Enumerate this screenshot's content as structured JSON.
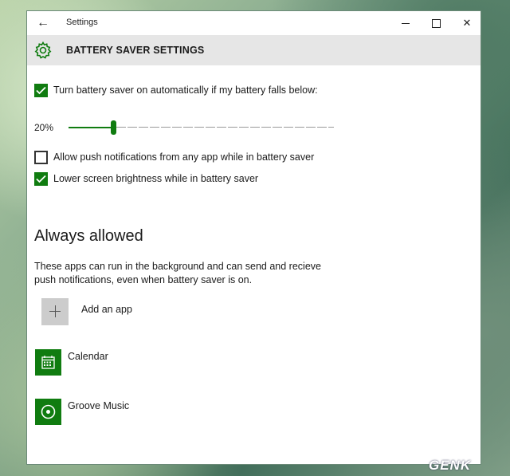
{
  "window": {
    "title": "Settings",
    "back_glyph": "←",
    "close_glyph": "✕"
  },
  "header": {
    "icon": "gear-icon",
    "title": "BATTERY SAVER SETTINGS"
  },
  "settings": {
    "auto_on": {
      "checked": true,
      "label": "Turn battery saver on automatically if my battery falls below:"
    },
    "threshold": {
      "value_label": "20%",
      "value_percent": 20
    },
    "push_notifications": {
      "checked": false,
      "label": "Allow push notifications from any app while in battery saver"
    },
    "lower_brightness": {
      "checked": true,
      "label": "Lower screen brightness while in battery saver"
    }
  },
  "always_allowed": {
    "title": "Always allowed",
    "description": "These apps can run in the background and can send and recieve push notifications, even when battery saver is on.",
    "add_label": "Add an app",
    "apps": [
      {
        "name": "Calendar",
        "icon": "calendar-icon"
      },
      {
        "name": "Groove Music",
        "icon": "music-disc-icon"
      }
    ]
  },
  "colors": {
    "accent": "#107c10",
    "header_bg": "#e6e6e6"
  },
  "watermark": "GENK"
}
